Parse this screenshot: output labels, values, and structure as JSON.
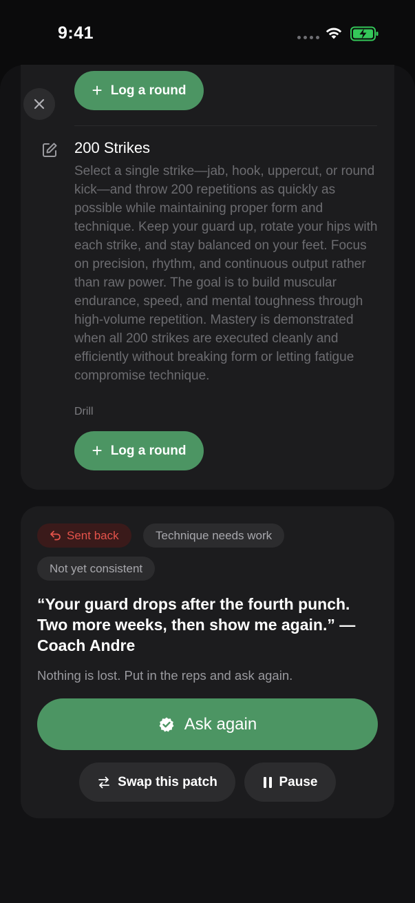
{
  "status_bar": {
    "time": "9:41"
  },
  "colors": {
    "accent_green": "#4c9563",
    "sent_back_red": "#e5534b",
    "battery_green": "#34c759",
    "card_bg": "#1c1c1e"
  },
  "icons": {
    "close": "close-icon",
    "edit": "edit-icon",
    "plus": "plus-icon",
    "undo": "undo-arrow-icon",
    "verified": "verified-badge-icon",
    "swap": "swap-arrows-icon",
    "pause": "pause-icon",
    "wifi": "wifi-icon",
    "battery": "battery-charging-icon"
  },
  "drill_card": {
    "log_round_label_top": "Log a round",
    "title": "200 Strikes",
    "description": "Select a single strike—jab, hook, uppercut, or round kick—and throw 200 repetitions as quickly as possible while maintaining proper form and technique. Keep your guard up, rotate your hips with each strike, and stay balanced on your feet. Focus on precision, rhythm, and continuous output rather than raw power. The goal is to build muscular endurance, speed, and mental toughness through high-volume repetition. Mastery is demonstrated when all 200 strikes are executed cleanly and efficiently without breaking form or letting fatigue compromise technique.",
    "type": "Drill",
    "log_round_label": "Log a round"
  },
  "review_card": {
    "status_chip": "Sent back",
    "tags": [
      "Technique needs work",
      "Not yet consistent"
    ],
    "quote": "“Your guard drops after the fourth punch. Two more weeks, then show me again.” — Coach Andre",
    "encouragement": "Nothing is lost. Put in the reps and ask again.",
    "ask_again_label": "Ask again",
    "swap_label": "Swap this patch",
    "pause_label": "Pause"
  }
}
